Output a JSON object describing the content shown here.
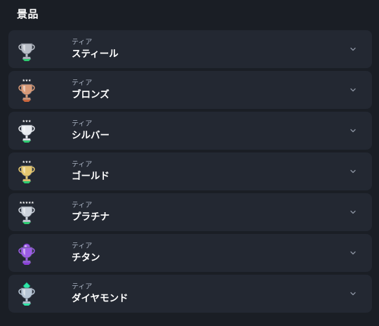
{
  "page": {
    "title": "景品"
  },
  "tiers": [
    {
      "label": "ティア",
      "name": "スティール",
      "icon": "steel-trophy-icon",
      "color": "#b8bdc6",
      "accent": "#2ecc71"
    },
    {
      "label": "ティア",
      "name": "ブロンズ",
      "icon": "bronze-trophy-icon",
      "color": "#d89a78",
      "accent": "#c9663e"
    },
    {
      "label": "ティア",
      "name": "シルバー",
      "icon": "silver-trophy-icon",
      "color": "#e8ebf0",
      "accent": "#2ecc71"
    },
    {
      "label": "ティア",
      "name": "ゴールド",
      "icon": "gold-trophy-icon",
      "color": "#e6c870",
      "accent": "#2ecc71"
    },
    {
      "label": "ティア",
      "name": "プラチナ",
      "icon": "platinum-trophy-icon",
      "color": "#cdd3dc",
      "accent": "#2ecc71"
    },
    {
      "label": "ティア",
      "name": "チタン",
      "icon": "titanium-trophy-icon",
      "color": "#9b5de5",
      "accent": "#8a3fd8"
    },
    {
      "label": "ティア",
      "name": "ダイヤモンド",
      "icon": "diamond-trophy-icon",
      "color": "#b9c7d6",
      "accent": "#2ee6a8"
    }
  ],
  "chevron_icon": "chevron-down-icon"
}
